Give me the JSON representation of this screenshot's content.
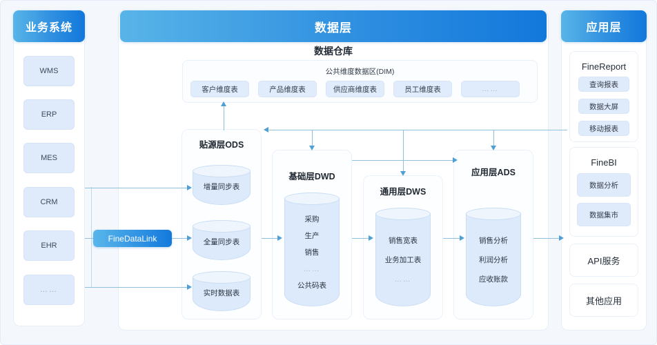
{
  "left_panel": {
    "header": "业务系统",
    "items": [
      {
        "label": "WMS"
      },
      {
        "label": "ERP"
      },
      {
        "label": "MES"
      },
      {
        "label": "CRM"
      },
      {
        "label": "EHR"
      },
      {
        "label": "……"
      }
    ]
  },
  "middle_panel": {
    "header": "数据层",
    "warehouse_title": "数据仓库",
    "dim": {
      "label": "公共维度数据区(DIM)",
      "tiles": [
        "客户维度表",
        "产品维度表",
        "供应商维度表",
        "员工维度表",
        "……"
      ]
    },
    "layers": [
      {
        "title": "贴源层ODS",
        "cylinders": [
          {
            "lines": [
              "增量同步表"
            ]
          },
          {
            "lines": [
              "全量同步表"
            ]
          },
          {
            "lines": [
              "实时数据表"
            ]
          }
        ]
      },
      {
        "title": "基础层DWD",
        "cylinders": [
          {
            "lines": [
              "采购",
              "生产",
              "销售",
              "……",
              "公共码表"
            ]
          }
        ]
      },
      {
        "title": "通用层DWS",
        "cylinders": [
          {
            "lines": [
              "销售宽表",
              "业务加工表",
              "……"
            ]
          }
        ]
      },
      {
        "title": "应用层ADS",
        "cylinders": [
          {
            "lines": [
              "销售分析",
              "利润分析",
              "应收账款"
            ]
          }
        ]
      }
    ]
  },
  "right_panel": {
    "header": "应用层",
    "cards": [
      {
        "title": "FineReport",
        "tiles": [
          "查询报表",
          "数据大屏",
          "移动报表"
        ]
      },
      {
        "title": "FineBI",
        "tiles": [
          "数据分析",
          "数据集市"
        ]
      }
    ],
    "plain_cards": [
      "API服务",
      "其他应用"
    ]
  },
  "connector": {
    "fine_data_link_label": "FineDataLink"
  },
  "colors": {
    "header_gradient_start": "#58b4e8",
    "header_gradient_end": "#1278db",
    "tile_fill": "#dfeafb",
    "cylinder_fill": "#ddeafb",
    "arrow": "#4f9fd4",
    "canvas_bg": "#f4f8fd"
  }
}
